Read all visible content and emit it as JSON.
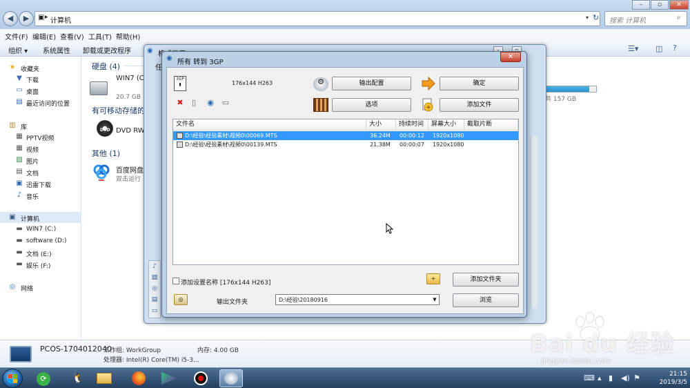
{
  "explorer": {
    "address": "计算机",
    "search_placeholder": "搜索 计算机",
    "menu": [
      "文件(F)",
      "编辑(E)",
      "查看(V)",
      "工具(T)",
      "帮助(H)"
    ],
    "commands": [
      "组织 ▾",
      "系统属性",
      "卸载或更改程序"
    ],
    "nav": {
      "favorites_title": "收藏夹",
      "favorites": [
        "下载",
        "桌面",
        "最近访问的位置"
      ],
      "libraries_title": "库",
      "libraries": [
        "PPTV视频",
        "视频",
        "图片",
        "文档",
        "迅雷下载",
        "音乐"
      ],
      "computer_title": "计算机",
      "drives": [
        "WIN7 (C:)",
        "software (D:)",
        "文档 (E:)",
        "娱乐 (F:)"
      ],
      "network_title": "网络"
    },
    "sections": {
      "hard_disks": "硬盘 (4)",
      "removable": "有可移动存储的",
      "other": "其他 (1)"
    },
    "items": {
      "c_drive_name": "WIN7 (C:",
      "c_drive_free": "20.7 GB",
      "dvd_name": "DVD RW",
      "other_drive_free": "共 157 GB",
      "other_drive_fill": 0.86,
      "baidu_name": "百度网盘",
      "baidu_sub": "双击运行"
    },
    "details": {
      "pc_name": "PCOS-1704012040",
      "workgroup": "工作组: WorkGroup",
      "memory": "内存: 4.00 GB",
      "cpu": "处理器: Intel(R) Core(TM) i5-3..."
    }
  },
  "ff_back_window": {
    "title": "格式工厂 2.50",
    "tab_char": "任"
  },
  "dialog": {
    "title": "所有 转到 3GP",
    "profile": "176x144 H263",
    "buttons": {
      "output_config": "输出配置",
      "ok": "确定",
      "options": "选项",
      "add_file": "添加文件",
      "add_folder": "添加文件夹",
      "browse": "浏览"
    },
    "columns": [
      "文件名",
      "大小",
      "持续时间",
      "屏幕大小",
      "截取片断"
    ],
    "files": [
      {
        "name": "D:\\经验\\经验素材\\视频0\\00069.MTS",
        "size": "36.24M",
        "duration": "00:00:12",
        "screen": "1920x1080",
        "clip": ""
      },
      {
        "name": "D:\\经验\\经验素材\\视频0\\00139.MTS",
        "size": "21.38M",
        "duration": "00:00:07",
        "screen": "1920x1080",
        "clip": ""
      }
    ],
    "add_setting_name_label": "添加设置名称 [176x144 H263]",
    "output_folder_label": "输出文件夹",
    "output_folder_value": "D:\\经验\\20180916"
  },
  "taskbar": {
    "time": "21:15",
    "date": "2019/3/5"
  },
  "watermark": {
    "logo": "Bai du 经验",
    "url": "jingyan.baidu.com"
  },
  "colors": {
    "selection": "#3399ff",
    "taskbar": "#2f4f74",
    "dialog_frame": "#bcd0e6",
    "close_red": "#c7402a"
  }
}
